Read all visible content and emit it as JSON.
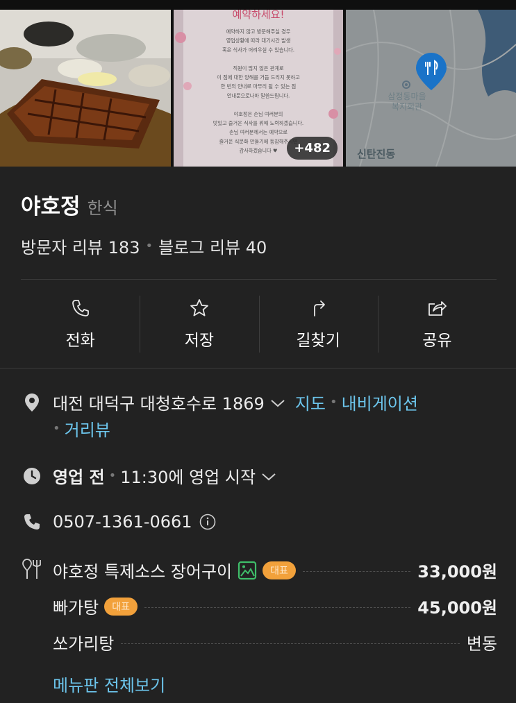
{
  "photos": {
    "notice_title": "예약하세요!",
    "notice_lines": [
      "예약하지 않고 방문해주실 경우",
      "영업상황에 따라 대기시간 발생",
      "혹은 식사가 어려우실 수 있습니다.",
      "",
      "직원이 많지 않은 관계로",
      "이 점에 대한 양해를 거듭 드리지 못하고",
      "한 번의 안내로 마무리 될 수 있는 점",
      "안내문으로나마 말씀드립니다.",
      "",
      "야호정은 손님 여러분의",
      "맛있고 즐거운 식사를 위해 노력하겠습니다.",
      "손님 여러분께서는 예약으로",
      "즐거운 식문화 만들기에 동참해주시면",
      "감사하겠습니다 ♥"
    ],
    "more_count": "+482",
    "map_poi_label": "삼정동마을 복지회관",
    "map_area_label": "신탄진동"
  },
  "place": {
    "name": "야호정",
    "category": "한식",
    "visitor_reviews": "방문자 리뷰 183",
    "blog_reviews": "블로그 리뷰 40"
  },
  "actions": [
    {
      "label": "전화",
      "icon": "phone-outline-icon"
    },
    {
      "label": "저장",
      "icon": "star-outline-icon"
    },
    {
      "label": "길찾기",
      "icon": "directions-icon"
    },
    {
      "label": "공유",
      "icon": "share-icon"
    }
  ],
  "info": {
    "address": "대전 대덕구 대청호수로 1869",
    "map_link": "지도",
    "nav_link": "내비게이션",
    "street_link": "거리뷰",
    "hours_status": "영업 전",
    "hours_detail": "11:30에 영업 시작",
    "phone": "0507-1361-0661"
  },
  "menu": {
    "items": [
      {
        "name": "야호정 특제소스 장어구이",
        "tag": "대표",
        "has_image": true,
        "price": "33,000원"
      },
      {
        "name": "빠가탕",
        "tag": "대표",
        "has_image": false,
        "price": "45,000원"
      },
      {
        "name": "쏘가리탕",
        "tag": "",
        "has_image": false,
        "price": "변동"
      }
    ],
    "see_all": "메뉴판 전체보기"
  },
  "colors": {
    "background": "#222222",
    "link": "#6cc5ec",
    "tag": "#f2a13b",
    "map_pin": "#1a73c8"
  }
}
